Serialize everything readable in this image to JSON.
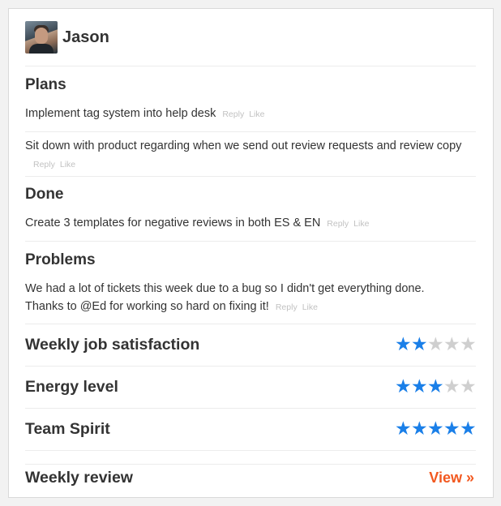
{
  "user": {
    "name": "Jason"
  },
  "plans": {
    "title": "Plans",
    "items": [
      {
        "text": "Implement tag system into help desk",
        "reply": "Reply",
        "like": "Like"
      },
      {
        "text": "Sit down with product regarding when we send out review requests and review copy",
        "reply": "Reply",
        "like": "Like"
      }
    ]
  },
  "done": {
    "title": "Done",
    "items": [
      {
        "text": "Create 3 templates for negative reviews in both ES & EN",
        "reply": "Reply",
        "like": "Like"
      }
    ]
  },
  "problems": {
    "title": "Problems",
    "items": [
      {
        "line1": "We had a lot of tickets this week due to a bug so I didn't get everything done.",
        "line2": "Thanks to @Ed for working so hard on fixing it!",
        "reply": "Reply",
        "like": "Like"
      }
    ]
  },
  "ratings": [
    {
      "label": "Weekly job satisfaction",
      "score": 2,
      "max": 5
    },
    {
      "label": "Energy level",
      "score": 3,
      "max": 5
    },
    {
      "label": "Team Spirit",
      "score": 5,
      "max": 5
    }
  ],
  "review": {
    "label": "Weekly review",
    "link": "View »"
  },
  "colors": {
    "star_on": "#1a7fe8",
    "star_off": "#cfcfcf",
    "link": "#f2581f"
  }
}
